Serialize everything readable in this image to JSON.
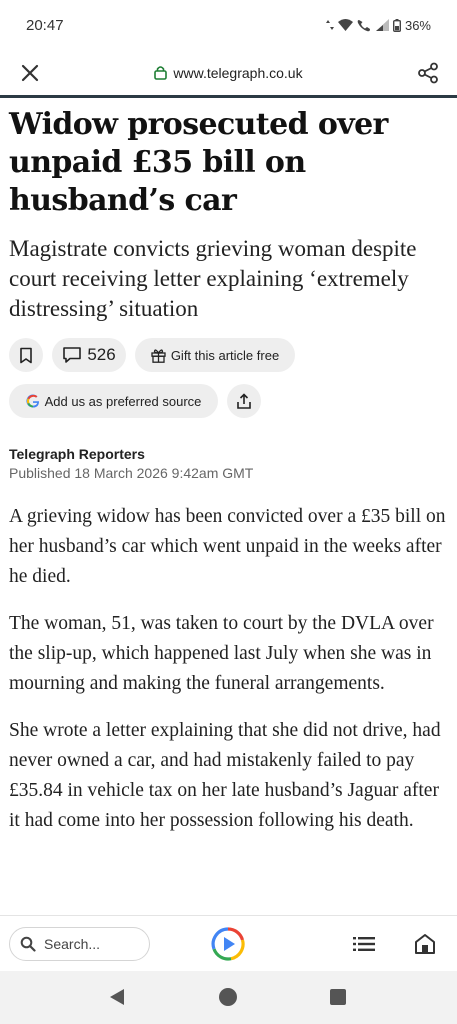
{
  "status": {
    "time": "20:47",
    "battery": "36%"
  },
  "browser": {
    "url": "www.telegraph.co.uk"
  },
  "article": {
    "headline": "Widow prosecuted over unpaid £35 bill on husband’s car",
    "standfirst": "Magistrate convicts grieving woman despite court receiving letter explaining ‘extremely distressing’ situation",
    "comment_count": "526",
    "gift_label": "Gift this article free",
    "preferred_source_label": "Add us as preferred source",
    "byline": "Telegraph Reporters",
    "published": "Published 18 March 2026 9:42am GMT",
    "paragraphs": [
      "A grieving widow has been convicted over a £35 bill on her husband’s car which went unpaid in the weeks after he died.",
      "The woman, 51, was taken to court by the DVLA over the slip-up, which happened last July when she was in mourning and making the funeral arrangements.",
      "She wrote a letter explaining that she did not drive, had never owned a car, and had mistakenly failed to pay £35.84 in vehicle tax on her late husband’s Jaguar after it had come into her possession following his death."
    ]
  },
  "bottom": {
    "search_placeholder": "Search..."
  },
  "icons": [
    "close-icon",
    "lock-icon",
    "share-icon",
    "bookmark-icon",
    "comment-icon",
    "gift-icon",
    "google-g-icon",
    "share-upload-icon",
    "search-icon",
    "google-play-icon",
    "list-icon",
    "home-icon",
    "back-icon",
    "home-circle-icon",
    "recents-icon"
  ],
  "colors": {
    "accent_line": "#2b3a44",
    "lock_green": "#1e7e34",
    "pill_bg": "#eeeeee"
  }
}
